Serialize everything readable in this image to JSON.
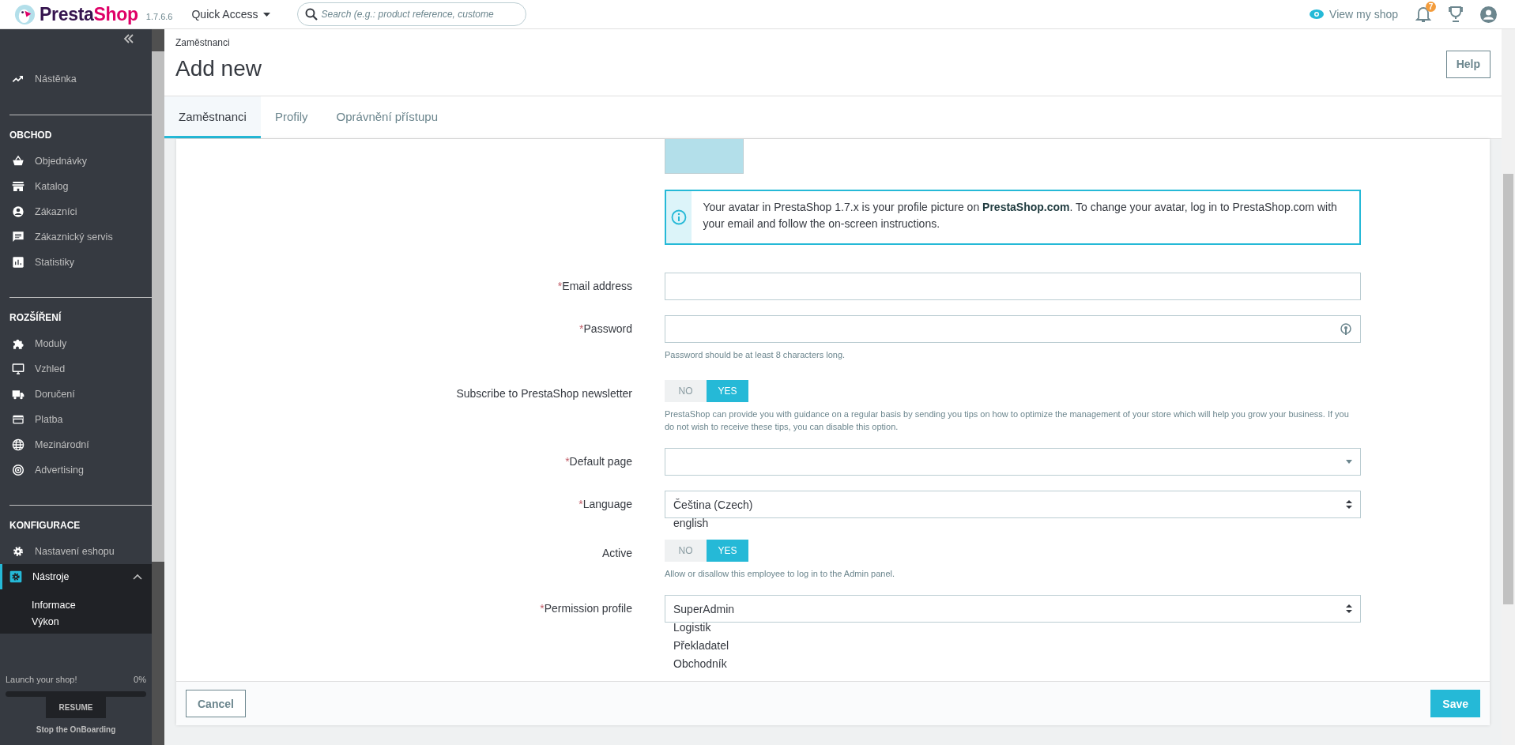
{
  "header": {
    "logo_text_1": "Presta",
    "logo_text_2": "Shop",
    "version": "1.7.6.6",
    "quick_access": "Quick Access",
    "search_placeholder": "Search (e.g.: product reference, custome",
    "view_shop": "View my shop",
    "notification_count": "7"
  },
  "sidebar": {
    "sections": [
      {
        "items": [
          {
            "label": "Nástěnka",
            "selected": false,
            "expanded": false
          }
        ]
      },
      {
        "title": "OBCHOD",
        "items": [
          {
            "label": "Objednávky",
            "selected": false,
            "expanded": false
          },
          {
            "label": "Katalog",
            "selected": false,
            "expanded": false
          },
          {
            "label": "Zákazníci",
            "selected": false,
            "expanded": false
          },
          {
            "label": "Zákaznický servis",
            "selected": false,
            "expanded": false
          },
          {
            "label": "Statistiky",
            "selected": false,
            "expanded": false
          }
        ]
      },
      {
        "title": "ROZŠÍŘENÍ",
        "items": [
          {
            "label": "Moduly",
            "selected": false,
            "expanded": false
          },
          {
            "label": "Vzhled",
            "selected": false,
            "expanded": false
          },
          {
            "label": "Doručení",
            "selected": false,
            "expanded": false
          },
          {
            "label": "Platba",
            "selected": false,
            "expanded": false
          },
          {
            "label": "Mezinárodní",
            "selected": false,
            "expanded": false
          },
          {
            "label": "Advertising",
            "selected": false,
            "expanded": false
          }
        ]
      },
      {
        "title": "KONFIGURACE",
        "items": [
          {
            "label": "Nastavení eshopu",
            "selected": false,
            "expanded": false
          },
          {
            "label": "Nástroje",
            "selected": true,
            "expanded": true,
            "children": [
              {
                "label": "Informace"
              },
              {
                "label": "Výkon"
              }
            ]
          }
        ]
      }
    ]
  },
  "onboarding": {
    "label": "Launch your shop!",
    "percent": "0%",
    "level": 0,
    "resume": "RESUME",
    "stop": "Stop the OnBoarding"
  },
  "page": {
    "breadcrumb": "Zaměstnanci",
    "title": "Add new",
    "help": "Help"
  },
  "tabs": [
    {
      "label": "Zaměstnanci",
      "selected": true
    },
    {
      "label": "Profily",
      "selected": false
    },
    {
      "label": "Oprávnění přístupu",
      "selected": false
    }
  ],
  "form": {
    "info": "Your avatar in PrestaShop 1.7.x is your profile picture on **PrestaShop.com**. To change your avatar, log in to PrestaShop.com with your email and follow the on-screen instructions.",
    "fields": [
      {
        "kind": "text",
        "required_mark": "*",
        "label": "Email address"
      },
      {
        "kind": "password",
        "required_mark": "*",
        "label": "Password",
        "hint": "Password should be at least 8 characters long."
      },
      {
        "kind": "toggle",
        "label": "Subscribe to PrestaShop newsletter",
        "off_label": "NO",
        "on_label": "YES",
        "on": true,
        "hint": "PrestaShop can provide you with guidance on a regular basis by sending you tips on how to optimize the management of your store which will help you grow your business. If you do not wish to receive these tips, you can disable this option."
      },
      {
        "kind": "dropdown",
        "required_mark": "*",
        "label": "Default page"
      },
      {
        "kind": "select",
        "required_mark": "*",
        "label": "Language",
        "value": "Čeština (Czech)",
        "listed_options": [
          "english"
        ]
      },
      {
        "kind": "toggle",
        "label": "Active",
        "off_label": "NO",
        "on_label": "YES",
        "on": true,
        "hint": "Allow or disallow this employee to log in to the Admin panel."
      },
      {
        "kind": "select",
        "required_mark": "*",
        "label": "Permission profile",
        "value": "SuperAdmin",
        "listed_options": [
          "Logistik",
          "Překladatel",
          "Obchodník"
        ]
      }
    ],
    "cancel": "Cancel",
    "save": "Save"
  }
}
